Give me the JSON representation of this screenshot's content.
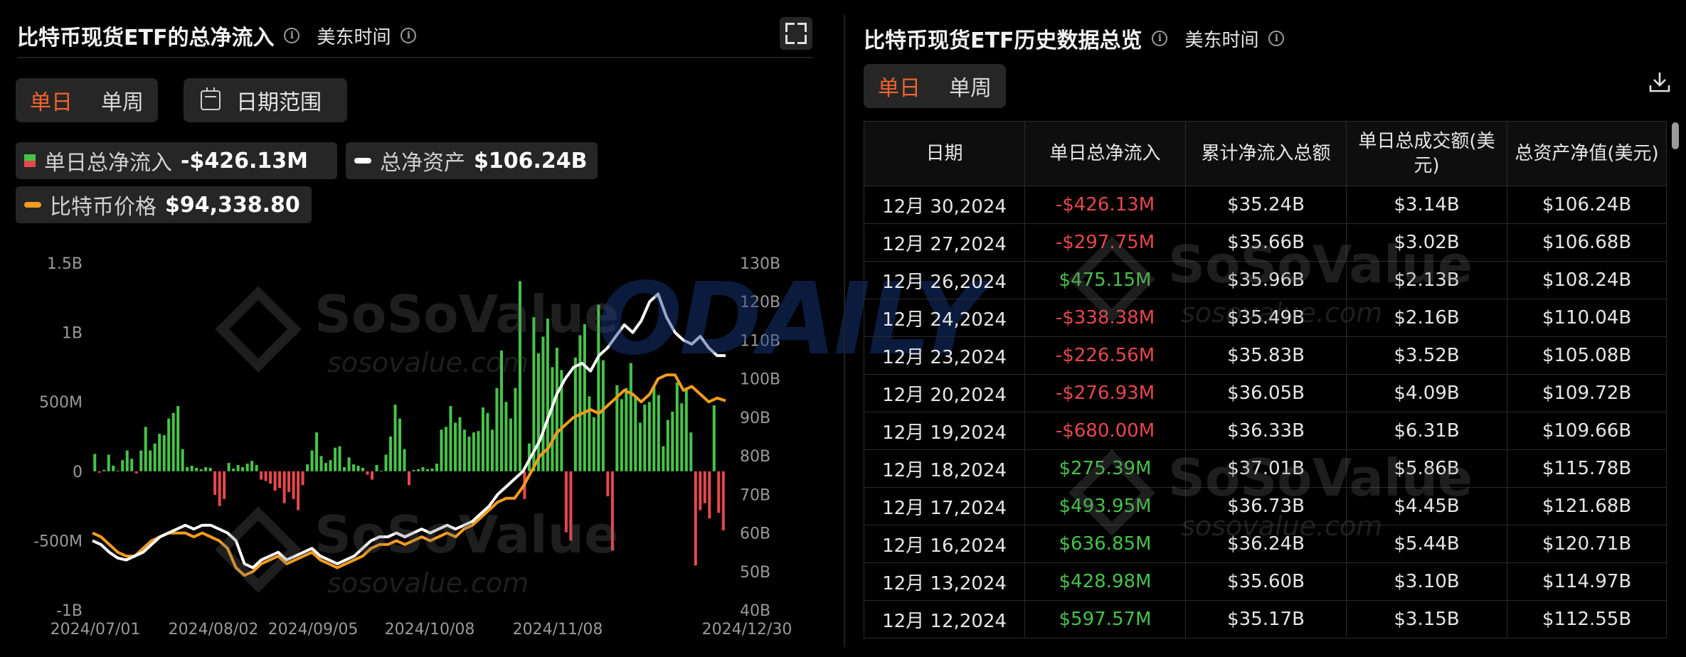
{
  "left": {
    "title": "比特币现货ETF的总净流入",
    "timezone": "美东时间",
    "toggle": {
      "day": "单日",
      "week": "单周"
    },
    "date_range": "日期范围",
    "legend": [
      {
        "label": "单日总净流入",
        "value": "-$426.13M"
      },
      {
        "label": "总净资产",
        "value": "$106.24B"
      },
      {
        "label": "比特币价格",
        "value": "$94,338.80"
      }
    ]
  },
  "right": {
    "title": "比特币现货ETF历史数据总览",
    "timezone": "美东时间",
    "toggle": {
      "day": "单日",
      "week": "单周"
    },
    "table": {
      "headers": [
        "日期",
        "单日总净流入",
        "累计净流入总额",
        "单日总成交额(美元)",
        "总资产净值(美元)"
      ],
      "rows": [
        [
          "12月 30,2024",
          "-$426.13M",
          "$35.24B",
          "$3.14B",
          "$106.24B"
        ],
        [
          "12月 27,2024",
          "-$297.75M",
          "$35.66B",
          "$3.02B",
          "$106.68B"
        ],
        [
          "12月 26,2024",
          "$475.15M",
          "$35.96B",
          "$2.13B",
          "$108.24B"
        ],
        [
          "12月 24,2024",
          "-$338.38M",
          "$35.49B",
          "$2.16B",
          "$110.04B"
        ],
        [
          "12月 23,2024",
          "-$226.56M",
          "$35.83B",
          "$3.52B",
          "$105.08B"
        ],
        [
          "12月 20,2024",
          "-$276.93M",
          "$36.05B",
          "$4.09B",
          "$109.72B"
        ],
        [
          "12月 19,2024",
          "-$680.00M",
          "$36.33B",
          "$6.31B",
          "$109.66B"
        ],
        [
          "12月 18,2024",
          "$275.39M",
          "$37.01B",
          "$5.86B",
          "$115.78B"
        ],
        [
          "12月 17,2024",
          "$493.95M",
          "$36.73B",
          "$4.45B",
          "$121.68B"
        ],
        [
          "12月 16,2024",
          "$636.85M",
          "$36.24B",
          "$5.44B",
          "$120.71B"
        ],
        [
          "12月 13,2024",
          "$428.98M",
          "$35.60B",
          "$3.10B",
          "$114.97B"
        ],
        [
          "12月 12,2024",
          "$597.57M",
          "$35.17B",
          "$3.15B",
          "$112.55B"
        ]
      ]
    }
  },
  "watermarks": {
    "brand": "SoSoValue",
    "site": "sosovalue.com",
    "odaily": "ODAILY"
  },
  "colors": {
    "accent": "#f0642e",
    "inflow": "#46c34a",
    "outflow": "#e5484d",
    "price": "#f39c1f",
    "assets": "#ffffff"
  },
  "chart_data": {
    "type": "bar",
    "y_left_ticks": [
      "1.5B",
      "1B",
      "500M",
      "0",
      "-500M",
      "-1B"
    ],
    "y_right_ticks": [
      "130B",
      "120B",
      "110B",
      "100B",
      "90B",
      "80B",
      "70B",
      "60B",
      "50B",
      "40B"
    ],
    "x_ticks": [
      "2024/07/01",
      "2024/08/02",
      "2024/09/05",
      "2024/10/08",
      "2024/11/08",
      "2024/12/30"
    ],
    "ylim_left": [
      -1000,
      1500
    ],
    "ylim_right": [
      40,
      130
    ],
    "flows_musd": [
      125,
      -10,
      10,
      120,
      40,
      5,
      80,
      150,
      90,
      -15,
      150,
      320,
      150,
      200,
      270,
      260,
      380,
      420,
      470,
      160,
      30,
      40,
      25,
      15,
      30,
      25,
      -170,
      -250,
      -200,
      60,
      20,
      45,
      30,
      55,
      75,
      45,
      -60,
      -70,
      -90,
      -140,
      -120,
      -230,
      -150,
      -200,
      -280,
      -100,
      50,
      150,
      280,
      110,
      60,
      80,
      170,
      180,
      30,
      100,
      50,
      40,
      25,
      -25,
      -60,
      45,
      5,
      120,
      250,
      480,
      380,
      160,
      -100,
      10,
      15,
      30,
      15,
      20,
      55,
      300,
      320,
      470,
      350,
      390,
      300,
      250,
      280,
      290,
      460,
      420,
      300,
      600,
      870,
      500,
      380,
      600,
      1370,
      -200,
      200,
      1110,
      850,
      970,
      1100,
      750,
      890,
      730,
      -440,
      -500,
      820,
      980,
      1060,
      540,
      390,
      1200,
      800,
      -180,
      -570,
      620,
      520,
      600,
      780,
      540,
      350,
      480,
      500,
      620,
      550,
      180,
      370,
      430,
      640,
      490,
      600,
      280,
      -680,
      -280,
      -230,
      -340,
      475,
      -300,
      -426
    ],
    "assets_b": [
      58,
      57,
      55,
      53.5,
      53,
      54,
      55,
      57,
      59,
      60,
      61,
      62,
      61,
      62,
      62,
      61,
      60,
      58,
      52,
      51,
      53,
      54,
      55,
      53,
      54,
      55,
      56,
      54,
      53,
      52,
      53,
      54,
      56,
      58,
      59,
      59,
      60,
      59,
      60,
      61,
      60,
      61,
      62,
      61,
      62,
      63,
      65,
      67,
      70,
      72,
      74,
      76,
      80,
      84,
      90,
      96,
      100,
      103,
      104,
      102,
      106,
      108,
      111,
      114,
      112,
      115,
      120,
      122,
      116,
      112,
      110,
      109,
      111,
      108,
      106,
      106
    ],
    "btc_price_k": [
      60,
      59,
      57,
      55,
      54,
      54,
      56,
      58,
      59,
      60,
      60,
      60,
      59,
      60,
      59,
      58,
      56,
      51,
      49,
      50,
      52,
      53,
      54,
      52,
      53,
      54,
      55,
      53,
      52,
      51,
      52,
      53,
      54,
      56,
      57,
      57,
      58,
      57,
      58,
      59,
      58,
      59,
      60,
      59,
      61,
      62,
      64,
      66,
      68,
      69,
      69,
      72,
      76,
      80,
      82,
      86,
      88,
      90,
      91,
      92,
      91,
      93,
      95,
      97,
      96,
      94,
      96,
      100,
      101,
      101,
      97,
      98,
      96,
      94,
      95,
      94.3
    ]
  }
}
